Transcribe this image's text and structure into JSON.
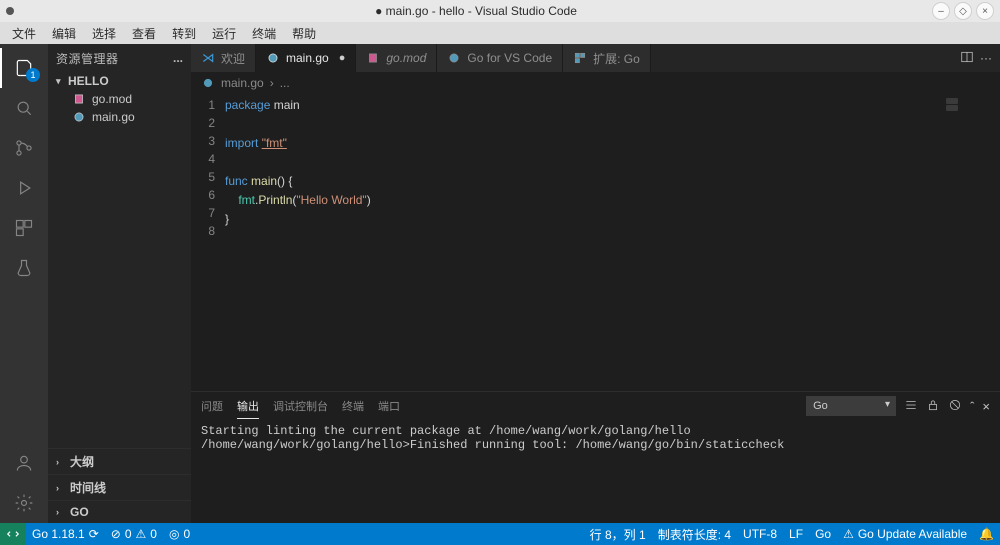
{
  "titlebar": {
    "modified_indicator": "●",
    "title": "main.go - hello - Visual Studio Code"
  },
  "os_menu": [
    "文件",
    "编辑",
    "选择",
    "查看",
    "转到",
    "运行",
    "终端",
    "帮助"
  ],
  "activity": {
    "explorer_badge": "1"
  },
  "sidebar": {
    "title": "资源管理器",
    "actions": "...",
    "project_name": "HELLO",
    "files": [
      {
        "name": "go.mod",
        "icon": "go-mod"
      },
      {
        "name": "main.go",
        "icon": "go"
      }
    ],
    "collapsed_sections": [
      "大纲",
      "时间线",
      "GO"
    ]
  },
  "tabs": [
    {
      "label": "欢迎",
      "icon": "vscode",
      "active": false,
      "italic": false,
      "dirty": false
    },
    {
      "label": "main.go",
      "icon": "go",
      "active": true,
      "italic": false,
      "dirty": true
    },
    {
      "label": "go.mod",
      "icon": "go-mod",
      "active": false,
      "italic": true,
      "dirty": false
    },
    {
      "label": "Go for VS Code",
      "icon": "go",
      "active": false,
      "italic": false,
      "dirty": false
    },
    {
      "label": "扩展: Go",
      "icon": "ext",
      "active": false,
      "italic": false,
      "dirty": false
    }
  ],
  "breadcrumbs": {
    "file_icon": "go",
    "file": "main.go",
    "sep": "›",
    "rest": "..."
  },
  "editor": {
    "line_numbers": [
      "1",
      "2",
      "3",
      "4",
      "5",
      "6",
      "7",
      "8"
    ],
    "code_tokens": [
      [
        {
          "t": "package",
          "c": "kw"
        },
        {
          "t": " main",
          "c": "pkg"
        }
      ],
      [
        {
          "t": "",
          "c": "pkg"
        }
      ],
      [
        {
          "t": "import",
          "c": "kw"
        },
        {
          "t": " ",
          "c": "pkg"
        },
        {
          "t": "\"fmt\"",
          "c": "strlink"
        }
      ],
      [
        {
          "t": "",
          "c": "pkg"
        }
      ],
      [
        {
          "t": "func",
          "c": "kw"
        },
        {
          "t": " ",
          "c": "pkg"
        },
        {
          "t": "main",
          "c": "func"
        },
        {
          "t": "() {",
          "c": "punc"
        }
      ],
      [
        {
          "t": "    ",
          "c": "pkg"
        },
        {
          "t": "fmt",
          "c": "type"
        },
        {
          "t": ".",
          "c": "punc"
        },
        {
          "t": "Println",
          "c": "call"
        },
        {
          "t": "(",
          "c": "punc"
        },
        {
          "t": "\"Hello World\"",
          "c": "str"
        },
        {
          "t": ")",
          "c": "punc"
        }
      ],
      [
        {
          "t": "}",
          "c": "punc"
        }
      ],
      [
        {
          "t": "",
          "c": "pkg"
        }
      ]
    ],
    "current_line_idx": 7
  },
  "panel": {
    "tabs": [
      "问题",
      "输出",
      "调试控制台",
      "终端",
      "端口"
    ],
    "active_tab_idx": 1,
    "channel": "Go",
    "output_lines": [
      "Starting linting the current package at /home/wang/work/golang/hello",
      "/home/wang/work/golang/hello>Finished running tool: /home/wang/go/bin/staticcheck"
    ]
  },
  "statusbar": {
    "go_version": "Go 1.18.1",
    "branch_icon": "⎇",
    "errors": "0",
    "warnings": "0",
    "radio": "0",
    "line_col": "行 8，列 1",
    "indent": "制表符长度: 4",
    "encoding": "UTF-8",
    "eol": "LF",
    "lang": "Go",
    "update": "Go Update Available",
    "analysis_icon": "⚠"
  }
}
